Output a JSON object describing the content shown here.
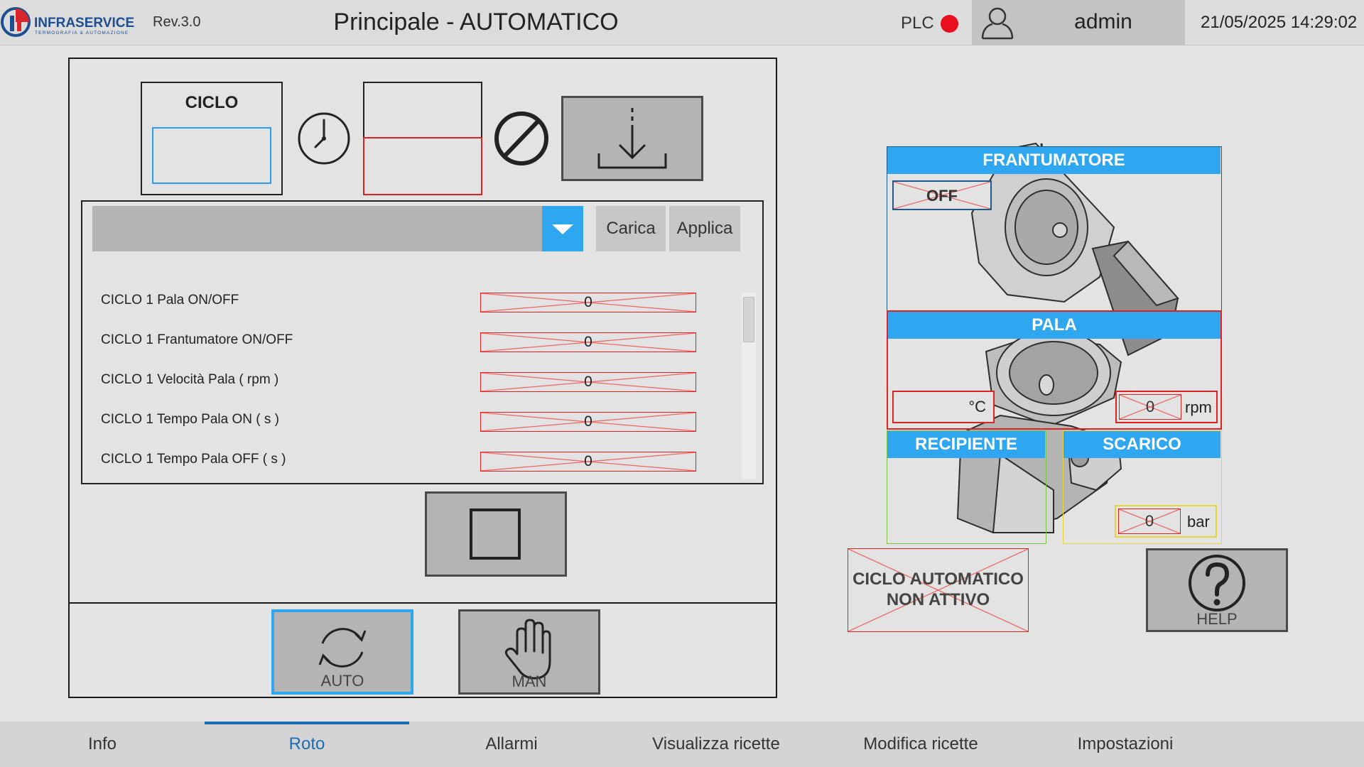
{
  "header": {
    "logo_text": "INFRASERVICE",
    "logo_subtext": "TERMOGRAFIA & AUTOMAZIONE",
    "revision": "Rev.3.0",
    "title": "Principale - AUTOMATICO",
    "plc_label": "PLC",
    "user": "admin",
    "datetime": "21/05/2025 14:29:02"
  },
  "colors": {
    "accent": "#2ea6f0",
    "alarm_red": "#e8101e",
    "frame": "#1a1a1a",
    "button_gray": "#b4b4b4",
    "status_red": "#d22222"
  },
  "ciclo": {
    "label": "CICLO",
    "value": ""
  },
  "recipe": {
    "selected": "",
    "carica_label": "Carica",
    "applica_label": "Applica",
    "params": [
      {
        "label": "CICLO 1 Pala ON/OFF",
        "value": "0"
      },
      {
        "label": "CICLO 1 Frantumatore ON/OFF",
        "value": "0"
      },
      {
        "label": "CICLO 1 Velocità Pala ( rpm )",
        "value": "0"
      },
      {
        "label": "CICLO 1 Tempo Pala ON ( s )",
        "value": "0"
      },
      {
        "label": "CICLO 1 Tempo Pala OFF ( s )",
        "value": "0"
      }
    ]
  },
  "mode_buttons": {
    "auto_label": "AUTO",
    "man_label": "MAN",
    "active": "AUTO"
  },
  "machine": {
    "frantumatore": {
      "label": "FRANTUMATORE",
      "state": "OFF"
    },
    "pala": {
      "label": "PALA",
      "temp_unit": "°C",
      "speed_value": "0",
      "speed_unit": "rpm"
    },
    "recipiente": {
      "label": "RECIPIENTE"
    },
    "scarico": {
      "label": "SCARICO",
      "pressure_value": "0",
      "pressure_unit": "bar"
    }
  },
  "cycle_status": {
    "line1": "CICLO AUTOMATICO",
    "line2": "NON ATTIVO"
  },
  "help_label": "HELP",
  "nav": {
    "active": "Roto",
    "tabs": [
      {
        "label": "Info"
      },
      {
        "label": "Roto"
      },
      {
        "label": "Allarmi"
      },
      {
        "label": "Visualizza ricette"
      },
      {
        "label": "Modifica ricette"
      },
      {
        "label": "Impostazioni"
      }
    ]
  }
}
